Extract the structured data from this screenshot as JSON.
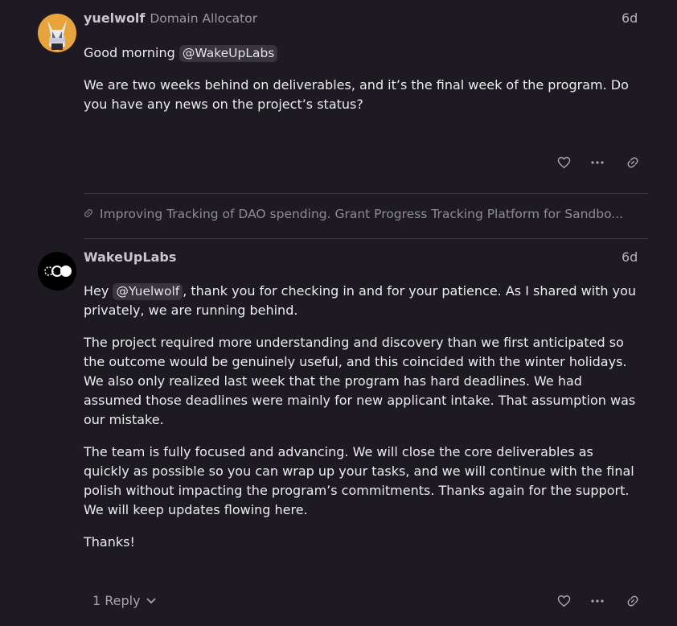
{
  "post1": {
    "username": "yuelwolf",
    "user_title": "Domain Allocator",
    "date": "6d",
    "greeting": "Good morning ",
    "mention": "@WakeUpLabs",
    "paragraph": "We are two weeks behind on deliverables, and it’s the final week of the program. Do you have any news on the project’s status?"
  },
  "linkback": {
    "text": "Improving Tracking of DAO spending. Grant Progress Tracking Platform for Sandbo..."
  },
  "post2": {
    "username": "WakeUpLabs",
    "date": "6d",
    "p1_prefix": "Hey ",
    "p1_mention": "@Yuelwolf",
    "p1_suffix": ", thank you for checking in and for your patience. As I shared with you privately, we are running behind.",
    "p2": "The project required more understanding and discovery than we first anticipated so the outcome would be genuinely useful, and this coincided with the winter holidays. We also only realized last week that the program has hard deadlines. We had assumed those deadlines were mainly for new applicant intake. That assumption was our mistake.",
    "p3": "The team is fully focused and advancing. We will close the core deliverables as quickly as possible so you can wrap up your tasks, and we will continue with the final polish without impacting the program’s commitments. Thanks again for the support. We will keep updates flowing here.",
    "p4": "Thanks!",
    "replies_label": "1 Reply"
  },
  "icons": {
    "like": "heart-icon",
    "more": "ellipsis-icon",
    "share": "link-icon",
    "expand": "chevron-down-icon"
  },
  "colors": {
    "background": "#1d1b21",
    "text": "#ecebee",
    "muted": "#9a979f",
    "mention_bg": "#38353d"
  }
}
